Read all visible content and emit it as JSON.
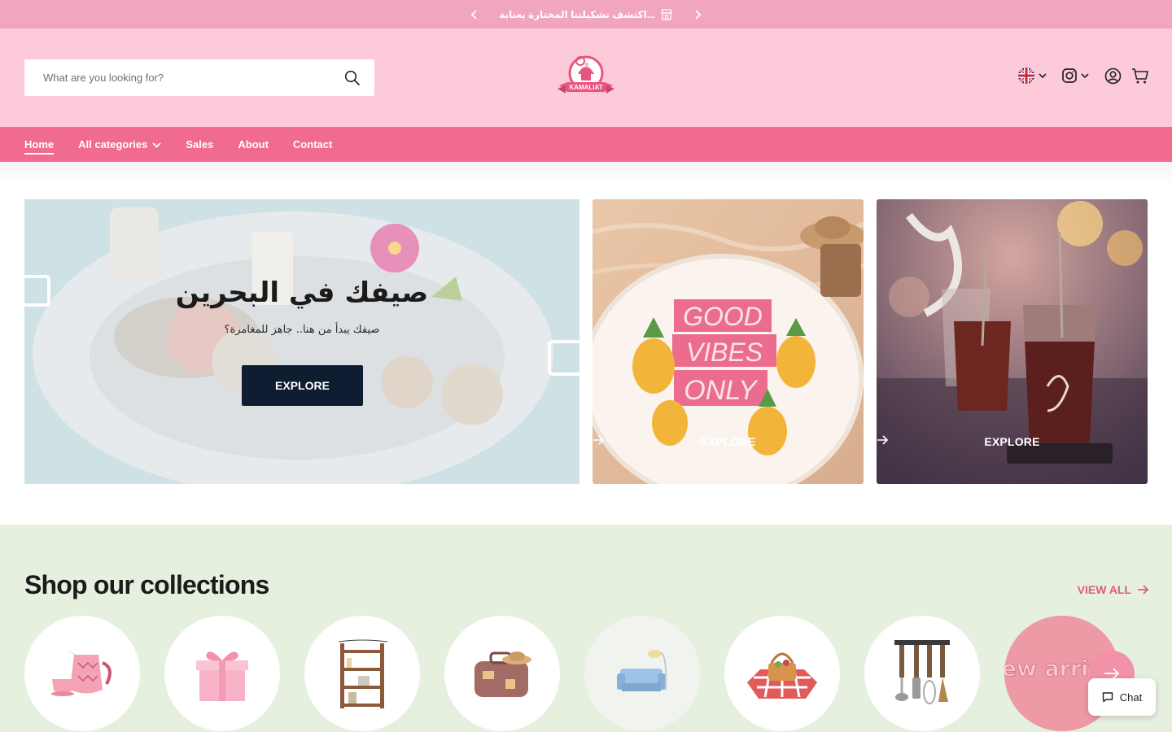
{
  "announcement": {
    "text": "...اكتشف تشكيلتنا المختارة بعناية",
    "prev_icon": "chevron-left-icon",
    "next_icon": "chevron-right-icon",
    "store_icon": "store-icon"
  },
  "header": {
    "search_placeholder": "What are you looking for?",
    "logo_text": "KAMALIAT",
    "language_flag": "uk-flag-icon",
    "social_icon": "instagram-icon",
    "account_icon": "user-circle-icon",
    "cart_icon": "cart-icon"
  },
  "nav": {
    "items": [
      {
        "label": "Home",
        "active": true
      },
      {
        "label": "All categories",
        "has_dropdown": true
      },
      {
        "label": "Sales"
      },
      {
        "label": "About"
      },
      {
        "label": "Contact"
      }
    ]
  },
  "hero": {
    "main": {
      "title": "صيفك في البحرين",
      "subtitle": "صيفك يبدأ من هنا.. جاهز للمغامرة؟",
      "button": "EXPLORE"
    },
    "card1": {
      "button": "EXPLORE",
      "banner_lines": [
        "GOOD",
        "VIBES",
        "ONLY"
      ]
    },
    "card2": {
      "button": "EXPLORE"
    }
  },
  "collections": {
    "title": "Shop our collections",
    "view_all": "VIEW ALL",
    "new_arrivals_text": "new arrivals",
    "items": [
      {
        "name": "teapot-set"
      },
      {
        "name": "gift-box"
      },
      {
        "name": "shelf"
      },
      {
        "name": "suitcase"
      },
      {
        "name": "sofa"
      },
      {
        "name": "picnic-basket"
      },
      {
        "name": "kitchen-utensils"
      },
      {
        "name": "new-arrivals"
      }
    ]
  },
  "chat": {
    "label": "Chat"
  },
  "colors": {
    "announcement_bg": "#f2a6be",
    "header_bg": "#fccad8",
    "nav_bg": "#f06b8e",
    "collections_bg": "#e6f0df",
    "accent": "#e05a82",
    "dark_button": "#0f1d33"
  }
}
